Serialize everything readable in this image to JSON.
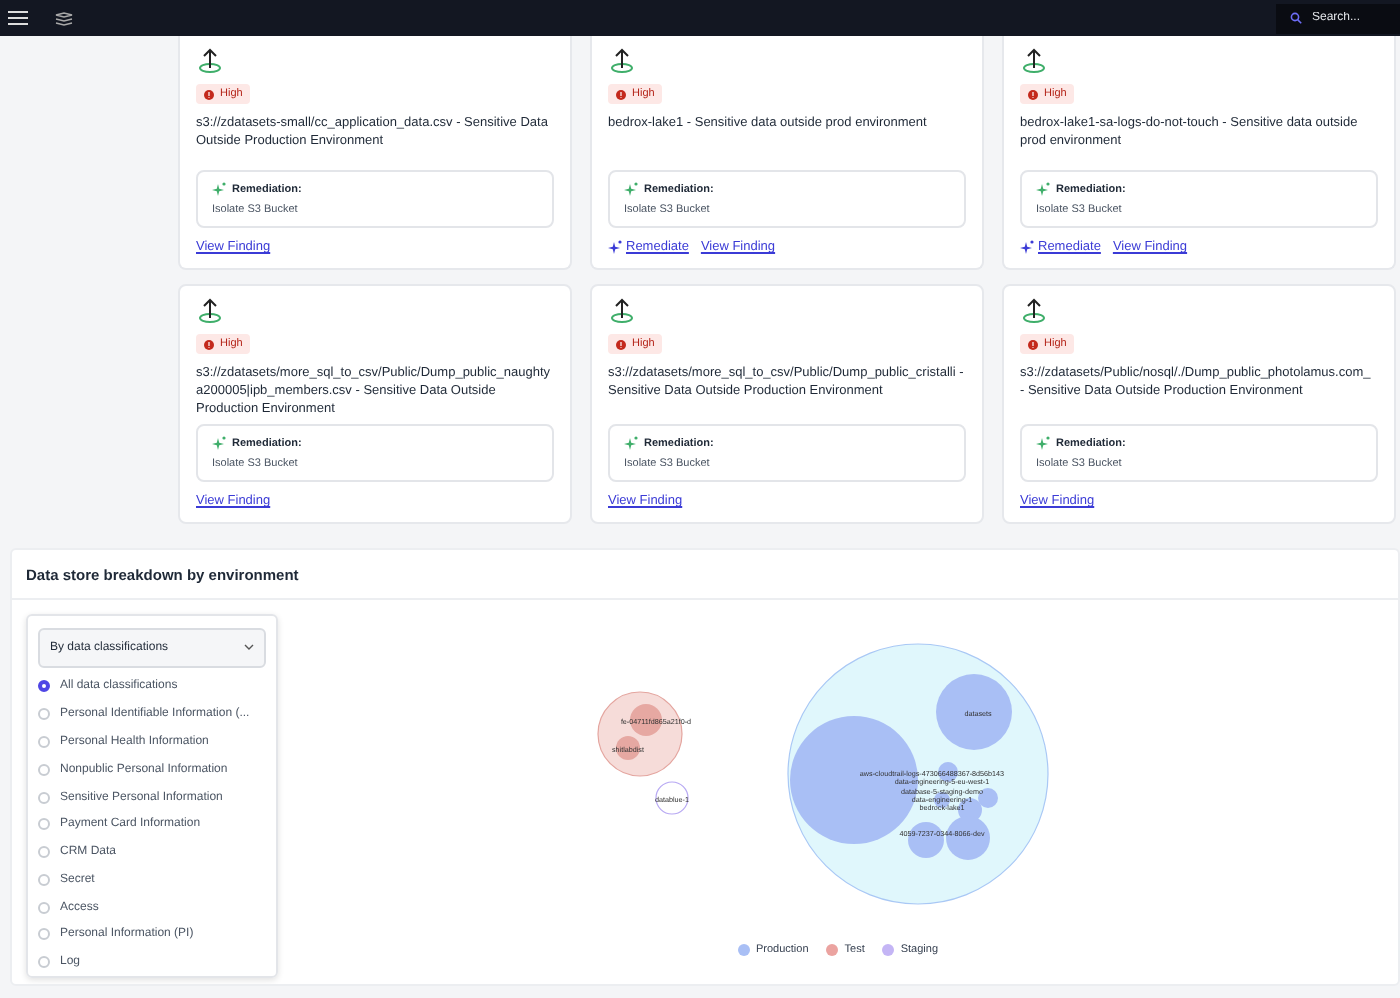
{
  "top_bar": {
    "search": {
      "placeholder": "Search..."
    }
  },
  "findings": [
    {
      "severity": "High",
      "title": "s3://zdatasets-small/cc_application_data.csv - Sensitive Data Outside Production Environment",
      "remediation": {
        "label": "Remediation:",
        "action": "Isolate S3 Bucket"
      },
      "links": [
        {
          "kind": "view",
          "label": "View Finding"
        }
      ]
    },
    {
      "severity": "High",
      "title": "bedrox-lake1 - Sensitive data outside prod environment",
      "remediation": {
        "label": "Remediation:",
        "action": "Isolate S3 Bucket"
      },
      "links": [
        {
          "kind": "remediate",
          "label": "Remediate"
        },
        {
          "kind": "view",
          "label": "View Finding"
        }
      ]
    },
    {
      "severity": "High",
      "title": "bedrox-lake1-sa-logs-do-not-touch - Sensitive data outside prod environment",
      "remediation": {
        "label": "Remediation:",
        "action": "Isolate S3 Bucket"
      },
      "links": [
        {
          "kind": "remediate",
          "label": "Remediate"
        },
        {
          "kind": "view",
          "label": "View Finding"
        }
      ]
    },
    {
      "severity": "High",
      "title": "s3://zdatasets/more_sql_to_csv/Public/Dump_public_naughtya200005|ipb_members.csv - Sensitive Data Outside Production Environment",
      "remediation": {
        "label": "Remediation:",
        "action": "Isolate S3 Bucket"
      },
      "links": [
        {
          "kind": "view",
          "label": "View Finding"
        }
      ]
    },
    {
      "severity": "High",
      "title": "s3://zdatasets/more_sql_to_csv/Public/Dump_public_cristalli - Sensitive Data Outside Production Environment",
      "remediation": {
        "label": "Remediation:",
        "action": "Isolate S3 Bucket"
      },
      "links": [
        {
          "kind": "view",
          "label": "View Finding"
        }
      ]
    },
    {
      "severity": "High",
      "title": "s3://zdatasets/Public/nosql/./Dump_public_photolamus.com_ - Sensitive Data Outside Production Environment",
      "remediation": {
        "label": "Remediation:",
        "action": "Isolate S3 Bucket"
      },
      "links": [
        {
          "kind": "view",
          "label": "View Finding"
        }
      ]
    }
  ],
  "breakdown": {
    "title": "Data store breakdown by environment",
    "dropdown": {
      "value": "By data classifications"
    },
    "classifications": [
      {
        "label": "All data classifications",
        "selected": true
      },
      {
        "label": "Personal Identifiable Information (...",
        "selected": false
      },
      {
        "label": "Personal Health Information",
        "selected": false
      },
      {
        "label": "Nonpublic Personal Information",
        "selected": false
      },
      {
        "label": "Sensitive Personal Information",
        "selected": false
      },
      {
        "label": "Payment Card Information",
        "selected": false
      },
      {
        "label": "CRM Data",
        "selected": false
      },
      {
        "label": "Secret",
        "selected": false
      },
      {
        "label": "Access",
        "selected": false
      },
      {
        "label": "Personal Information (PI)",
        "selected": false
      },
      {
        "label": "Log",
        "selected": false
      }
    ],
    "bubble_labels": [
      "fe-04711fd865a21f0-d",
      "shitlabdist",
      "datablue-1",
      "datasets",
      "aws-cloudtrail-logs-473066488367-8d56b143",
      "data-engineering-5-eu-west-1",
      "database-5-staging-demo",
      "data-engineering-1",
      "bedrock-lake1",
      "4059-7237-0344-8066-dev"
    ],
    "legend": [
      {
        "label": "Production",
        "color": "#a9bff5"
      },
      {
        "label": "Test",
        "color": "#eba3a0"
      },
      {
        "label": "Staging",
        "color": "#c4b5f5"
      }
    ]
  }
}
